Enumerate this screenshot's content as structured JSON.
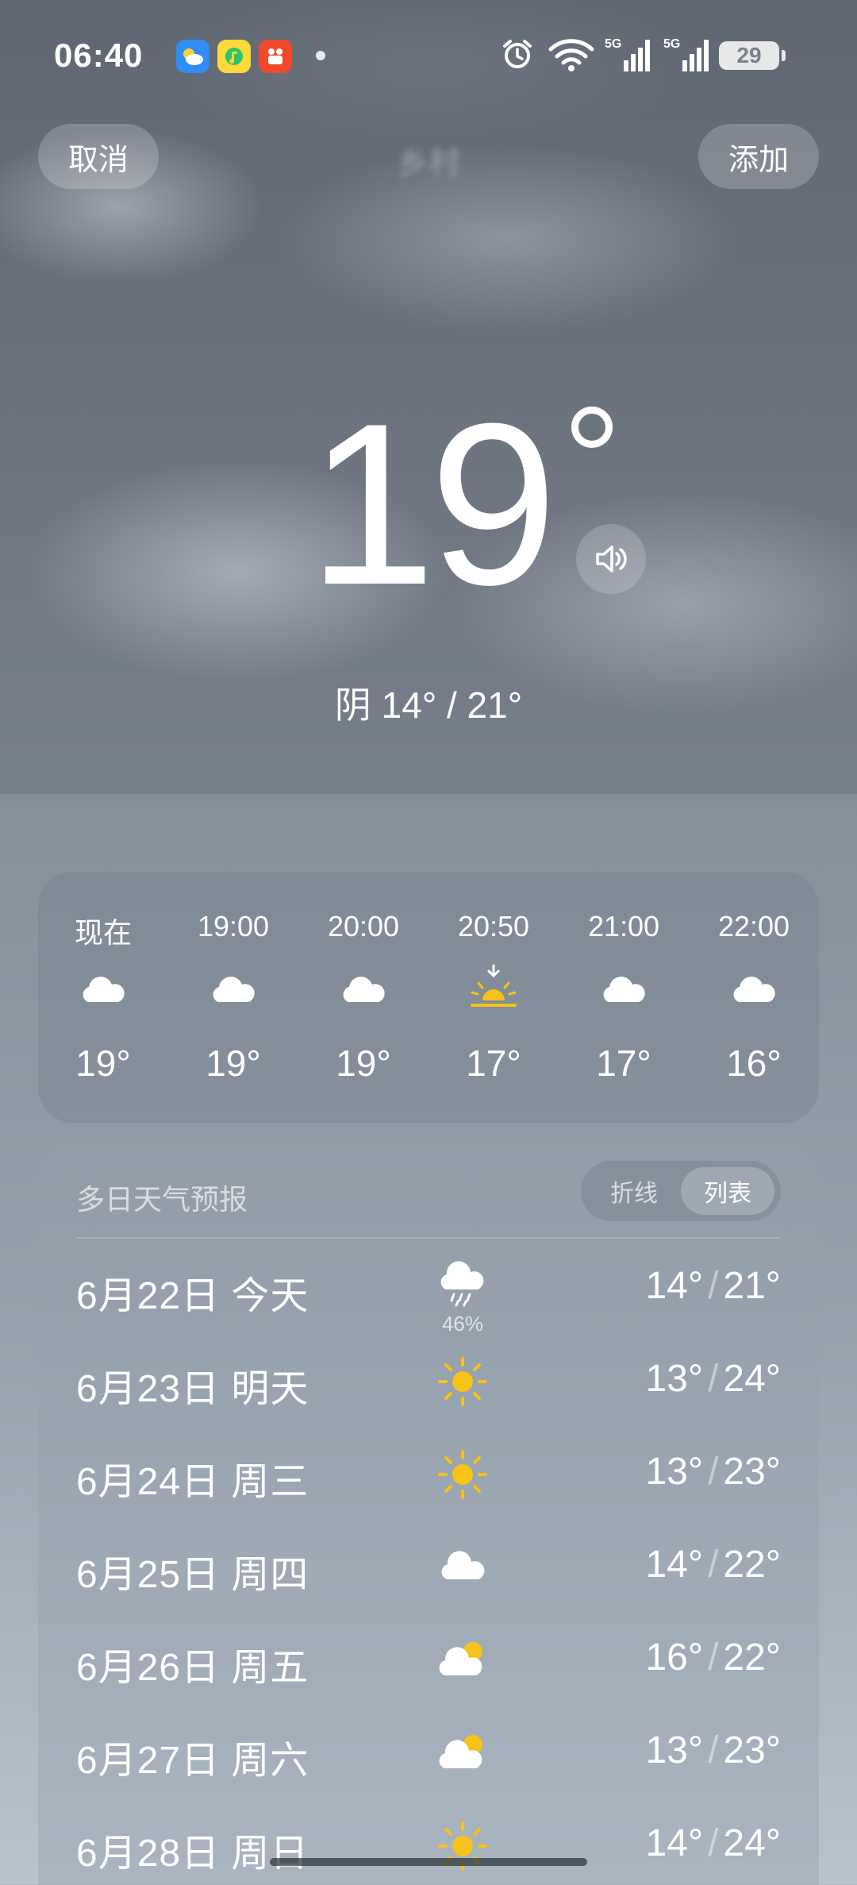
{
  "status_bar": {
    "time": "06:40",
    "apps": [
      "weather-app-icon",
      "music-app-icon",
      "video-app-icon"
    ],
    "battery": "29",
    "network": [
      "5G",
      "5G"
    ]
  },
  "header": {
    "cancel_label": "取消",
    "add_label": "添加",
    "city_blurred": "乡村"
  },
  "current": {
    "temp": "19",
    "condition_range": "阴  14° / 21°"
  },
  "hourly": [
    {
      "time": "现在",
      "icon": "cloud-icon",
      "temp": "19°"
    },
    {
      "time": "19:00",
      "icon": "cloud-icon",
      "temp": "19°"
    },
    {
      "time": "20:00",
      "icon": "cloud-icon",
      "temp": "19°"
    },
    {
      "time": "20:50",
      "icon": "sunset-icon",
      "temp": "17°"
    },
    {
      "time": "21:00",
      "icon": "cloud-icon",
      "temp": "17°"
    },
    {
      "time": "22:00",
      "icon": "cloud-icon",
      "temp": "16°"
    }
  ],
  "daily": {
    "title": "多日天气预报",
    "toggle": {
      "off": "折线",
      "on": "列表"
    },
    "rows": [
      {
        "date": "6月22日  今天",
        "icon": "rain-cloud-icon",
        "prob": "46%",
        "low": "14°",
        "high": "21°"
      },
      {
        "date": "6月23日  明天",
        "icon": "sun-icon",
        "prob": "",
        "low": "13°",
        "high": "24°"
      },
      {
        "date": "6月24日  周三",
        "icon": "sun-icon",
        "prob": "",
        "low": "13°",
        "high": "23°"
      },
      {
        "date": "6月25日  周四",
        "icon": "cloud-icon",
        "prob": "",
        "low": "14°",
        "high": "22°"
      },
      {
        "date": "6月26日  周五",
        "icon": "partly-cloudy-icon",
        "prob": "",
        "low": "16°",
        "high": "22°"
      },
      {
        "date": "6月27日  周六",
        "icon": "partly-cloudy-icon",
        "prob": "",
        "low": "13°",
        "high": "23°"
      },
      {
        "date": "6月28日  周日",
        "icon": "sun-icon",
        "prob": "",
        "low": "14°",
        "high": "24°"
      }
    ]
  },
  "colors": {
    "sun": "#f7c21a",
    "cloud": "#ffffff"
  }
}
